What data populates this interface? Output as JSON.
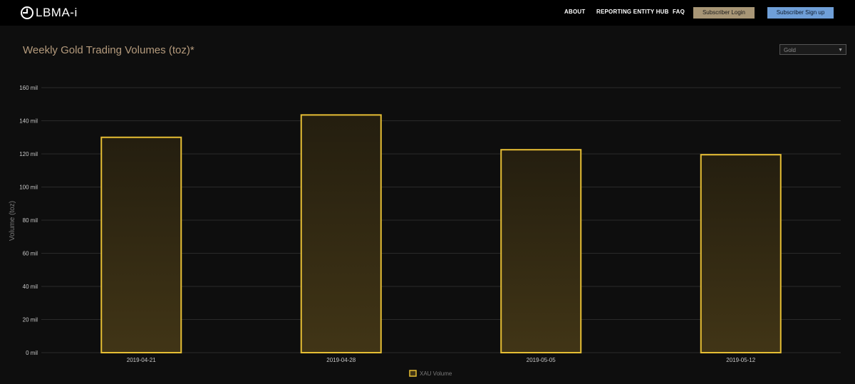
{
  "header": {
    "logo_text": "LBMA-i",
    "nav": {
      "about": "ABOUT",
      "hub": "REPORTING ENTITY HUB",
      "faq": "FAQ"
    },
    "login_label": "Subscriber Login",
    "signup_label": "Subscriber Sign up"
  },
  "main": {
    "title": "Weekly Gold Trading Volumes (toz)*",
    "metal_select": "Gold"
  },
  "colors": {
    "bar_stroke": "#e6be34",
    "bar_fill_top": "#241e0f",
    "bar_fill_bottom": "#413516",
    "grid": "#2a2a2a",
    "tick_text": "#c8c8c8",
    "axis_label": "#7a7a7a"
  },
  "chart_data": {
    "type": "bar",
    "categories": [
      "2019-04-21",
      "2019-04-28",
      "2019-05-05",
      "2019-05-12"
    ],
    "series": [
      {
        "name": "XAU Volume",
        "values": [
          130,
          143.5,
          122.5,
          119.5
        ]
      }
    ],
    "title": "",
    "xlabel": "",
    "ylabel": "Volume (toz)",
    "ylim": [
      0,
      160
    ],
    "yticks": [
      0,
      20,
      40,
      60,
      80,
      100,
      120,
      140,
      160
    ],
    "ytick_labels": [
      "0 mil",
      "20 mil",
      "40 mil",
      "60 mil",
      "80 mil",
      "100 mil",
      "120 mil",
      "140 mil",
      "160 mil"
    ],
    "grid": true,
    "legend": "bottom-center"
  }
}
